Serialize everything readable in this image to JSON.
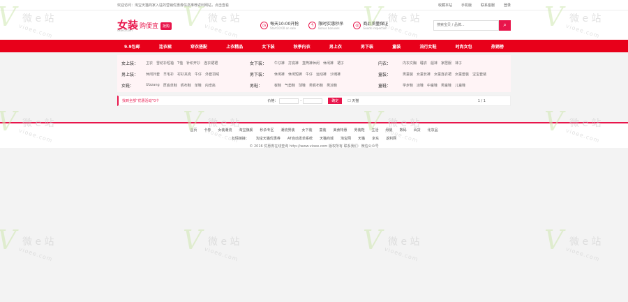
{
  "topbar": {
    "welcome": "欢迎访问：淘宝天猫商家入驻的营销优惠券信息推荐返利网站，点击查看",
    "links": [
      "收藏本站",
      "手机版",
      "联系客服",
      "登录"
    ]
  },
  "header": {
    "logo_main": "女装",
    "logo_sub": "购便宜",
    "logo_badge": "抢购",
    "logo_domain": "sxbe5.com",
    "features": [
      {
        "icon": "clock-icon",
        "glyph": "◷",
        "t1": "每天10:00开抢",
        "t2": "Start10:00 on sale"
      },
      {
        "icon": "lightning-icon",
        "glyph": "ϟ",
        "t1": "限时实惠秒杀",
        "t2": "Bonus bonuses"
      },
      {
        "icon": "shield-icon",
        "glyph": "◎",
        "t1": "商品质量保证",
        "t2": "Goods inspection"
      }
    ],
    "search_placeholder": "搜索宝贝 / 品牌...",
    "search_glyph": "⌕"
  },
  "nav": [
    "9.9包邮",
    "连衣裙",
    "穿衣搭配",
    "上衣精品",
    "女下装",
    "秋季内衣",
    "男上衣",
    "男下装",
    "童装",
    "流行女鞋",
    "时尚女包",
    "热销榜"
  ],
  "categories": [
    [
      {
        "title": "女上装：",
        "items": [
          "卫衣",
          "雪纺衫短袖",
          "T恤",
          "针织开衫",
          "连衣裙裙"
        ]
      },
      {
        "title": "女下装：",
        "items": [
          "牛仔裤",
          "打底裤",
          "直筒裤休闲",
          "休闲裤",
          "裙子"
        ]
      },
      {
        "title": "内衣：",
        "items": [
          "内衣文胸",
          "睡衣",
          "船袜",
          "家居服",
          "袜子"
        ]
      }
    ],
    [
      {
        "title": "男上装：",
        "items": [
          "休闲外套",
          "羊毛衫",
          "衬衫夹克",
          "牛仔",
          "外套羽绒"
        ]
      },
      {
        "title": "男下装：",
        "items": [
          "休闲裤",
          "休闲短裤",
          "牛仔",
          "运动裤",
          "沙滩裤"
        ]
      },
      {
        "title": "童装：",
        "items": [
          "男童装",
          "女童长裤",
          "女童连衣裙",
          "女童套装",
          "宝宝套装"
        ]
      }
    ],
    [
      {
        "title": "女鞋：",
        "items": [
          "Ulzzang",
          "厚底单鞋",
          "帆布鞋",
          "单鞋",
          "内增高"
        ]
      },
      {
        "title": "男鞋：",
        "items": [
          "板鞋",
          "气垫鞋",
          "球鞋",
          "男帆布鞋",
          "男凉鞋"
        ]
      },
      {
        "title": "童鞋：",
        "items": [
          "学步鞋",
          "凉鞋",
          "中童鞋",
          "男童鞋",
          "儿童鞋"
        ]
      }
    ]
  ],
  "filter": {
    "hint": "找到全部“优惠活动”0个",
    "price_label": "价格：",
    "separator": "-",
    "ok": "确定",
    "checkbox_label": "天猫",
    "pages": "1 / 1"
  },
  "footer": {
    "links": [
      "首页",
      "卡券",
      "女装潮流",
      "淘宝旗舰",
      "秒杀专区",
      "潮流男装",
      "女下装",
      "童装",
      "美食特惠",
      "男装鞋",
      "生活",
      "母婴",
      "数码",
      "百货",
      "化妆品"
    ],
    "friend_label": "友情链接：",
    "friends": [
      "淘宝天猫优惠券",
      "AT自动发单系统",
      "天猫商城",
      "淘宝网",
      "天猫",
      "京东",
      "返利网"
    ],
    "copyright": "© 2016 优惠券在线查询 http://www.vioee.com 版权所有 联系我们：微信公众号"
  },
  "watermark": {
    "big": "V",
    "cn": "微 e 站",
    "site": "vioee.com"
  }
}
